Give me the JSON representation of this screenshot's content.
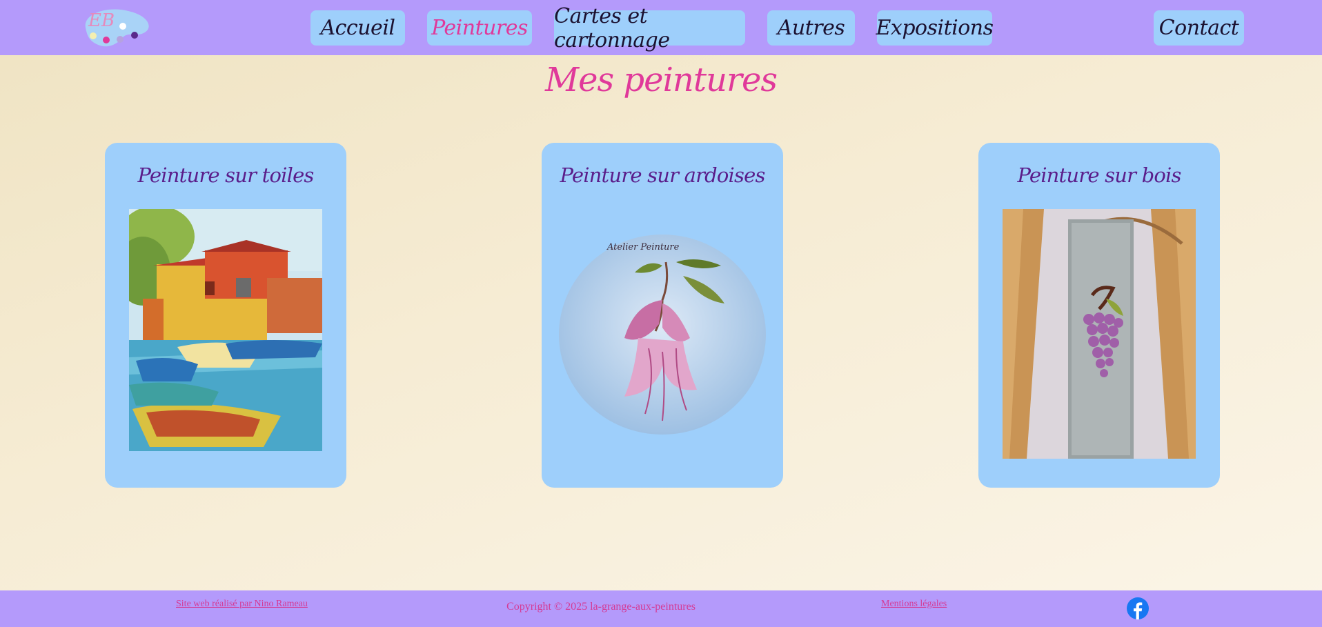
{
  "header": {
    "logo_text": "EB",
    "nav": [
      {
        "label": "Accueil",
        "active": false
      },
      {
        "label": "Peintures",
        "active": true
      },
      {
        "label": "Cartes et cartonnage",
        "active": false
      },
      {
        "label": "Autres",
        "active": false
      },
      {
        "label": "Expositions",
        "active": false
      }
    ],
    "contact_label": "Contact"
  },
  "main": {
    "title": "Mes peintures",
    "cards": [
      {
        "title": "Peinture sur toiles",
        "image": "harbor-painting"
      },
      {
        "title": "Peinture sur ardoises",
        "image": "fuchsia-slate-painting"
      },
      {
        "title": "Peinture sur bois",
        "image": "grapes-wood-painting"
      }
    ]
  },
  "footer": {
    "credit_link": "Site web réalisé par Nino Rameau",
    "copyright": "Copyright © 2025 la-grange-aux-peintures",
    "legal_link": "Mentions légales",
    "social_icon": "facebook-icon"
  },
  "colors": {
    "header_bg": "#b49afb",
    "button_bg": "#9ecffb",
    "accent_pink": "#e0399a",
    "card_title": "#5a1d8a"
  }
}
